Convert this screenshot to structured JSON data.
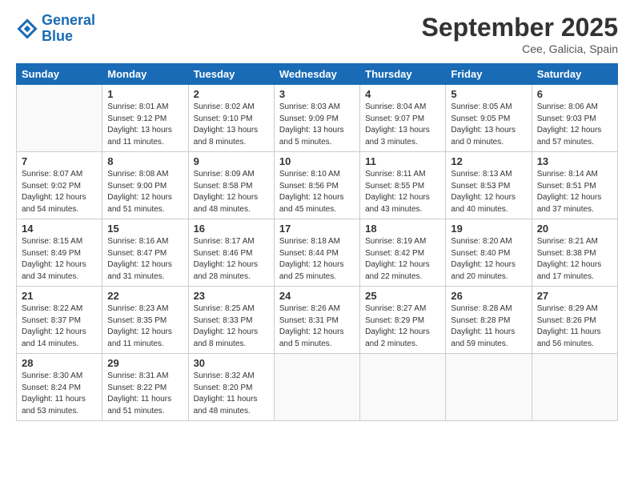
{
  "header": {
    "logo_line1": "General",
    "logo_line2": "Blue",
    "month_title": "September 2025",
    "subtitle": "Cee, Galicia, Spain"
  },
  "days_of_week": [
    "Sunday",
    "Monday",
    "Tuesday",
    "Wednesday",
    "Thursday",
    "Friday",
    "Saturday"
  ],
  "weeks": [
    [
      {
        "day": "",
        "info": ""
      },
      {
        "day": "1",
        "info": "Sunrise: 8:01 AM\nSunset: 9:12 PM\nDaylight: 13 hours\nand 11 minutes."
      },
      {
        "day": "2",
        "info": "Sunrise: 8:02 AM\nSunset: 9:10 PM\nDaylight: 13 hours\nand 8 minutes."
      },
      {
        "day": "3",
        "info": "Sunrise: 8:03 AM\nSunset: 9:09 PM\nDaylight: 13 hours\nand 5 minutes."
      },
      {
        "day": "4",
        "info": "Sunrise: 8:04 AM\nSunset: 9:07 PM\nDaylight: 13 hours\nand 3 minutes."
      },
      {
        "day": "5",
        "info": "Sunrise: 8:05 AM\nSunset: 9:05 PM\nDaylight: 13 hours\nand 0 minutes."
      },
      {
        "day": "6",
        "info": "Sunrise: 8:06 AM\nSunset: 9:03 PM\nDaylight: 12 hours\nand 57 minutes."
      }
    ],
    [
      {
        "day": "7",
        "info": "Sunrise: 8:07 AM\nSunset: 9:02 PM\nDaylight: 12 hours\nand 54 minutes."
      },
      {
        "day": "8",
        "info": "Sunrise: 8:08 AM\nSunset: 9:00 PM\nDaylight: 12 hours\nand 51 minutes."
      },
      {
        "day": "9",
        "info": "Sunrise: 8:09 AM\nSunset: 8:58 PM\nDaylight: 12 hours\nand 48 minutes."
      },
      {
        "day": "10",
        "info": "Sunrise: 8:10 AM\nSunset: 8:56 PM\nDaylight: 12 hours\nand 45 minutes."
      },
      {
        "day": "11",
        "info": "Sunrise: 8:11 AM\nSunset: 8:55 PM\nDaylight: 12 hours\nand 43 minutes."
      },
      {
        "day": "12",
        "info": "Sunrise: 8:13 AM\nSunset: 8:53 PM\nDaylight: 12 hours\nand 40 minutes."
      },
      {
        "day": "13",
        "info": "Sunrise: 8:14 AM\nSunset: 8:51 PM\nDaylight: 12 hours\nand 37 minutes."
      }
    ],
    [
      {
        "day": "14",
        "info": "Sunrise: 8:15 AM\nSunset: 8:49 PM\nDaylight: 12 hours\nand 34 minutes."
      },
      {
        "day": "15",
        "info": "Sunrise: 8:16 AM\nSunset: 8:47 PM\nDaylight: 12 hours\nand 31 minutes."
      },
      {
        "day": "16",
        "info": "Sunrise: 8:17 AM\nSunset: 8:46 PM\nDaylight: 12 hours\nand 28 minutes."
      },
      {
        "day": "17",
        "info": "Sunrise: 8:18 AM\nSunset: 8:44 PM\nDaylight: 12 hours\nand 25 minutes."
      },
      {
        "day": "18",
        "info": "Sunrise: 8:19 AM\nSunset: 8:42 PM\nDaylight: 12 hours\nand 22 minutes."
      },
      {
        "day": "19",
        "info": "Sunrise: 8:20 AM\nSunset: 8:40 PM\nDaylight: 12 hours\nand 20 minutes."
      },
      {
        "day": "20",
        "info": "Sunrise: 8:21 AM\nSunset: 8:38 PM\nDaylight: 12 hours\nand 17 minutes."
      }
    ],
    [
      {
        "day": "21",
        "info": "Sunrise: 8:22 AM\nSunset: 8:37 PM\nDaylight: 12 hours\nand 14 minutes."
      },
      {
        "day": "22",
        "info": "Sunrise: 8:23 AM\nSunset: 8:35 PM\nDaylight: 12 hours\nand 11 minutes."
      },
      {
        "day": "23",
        "info": "Sunrise: 8:25 AM\nSunset: 8:33 PM\nDaylight: 12 hours\nand 8 minutes."
      },
      {
        "day": "24",
        "info": "Sunrise: 8:26 AM\nSunset: 8:31 PM\nDaylight: 12 hours\nand 5 minutes."
      },
      {
        "day": "25",
        "info": "Sunrise: 8:27 AM\nSunset: 8:29 PM\nDaylight: 12 hours\nand 2 minutes."
      },
      {
        "day": "26",
        "info": "Sunrise: 8:28 AM\nSunset: 8:28 PM\nDaylight: 11 hours\nand 59 minutes."
      },
      {
        "day": "27",
        "info": "Sunrise: 8:29 AM\nSunset: 8:26 PM\nDaylight: 11 hours\nand 56 minutes."
      }
    ],
    [
      {
        "day": "28",
        "info": "Sunrise: 8:30 AM\nSunset: 8:24 PM\nDaylight: 11 hours\nand 53 minutes."
      },
      {
        "day": "29",
        "info": "Sunrise: 8:31 AM\nSunset: 8:22 PM\nDaylight: 11 hours\nand 51 minutes."
      },
      {
        "day": "30",
        "info": "Sunrise: 8:32 AM\nSunset: 8:20 PM\nDaylight: 11 hours\nand 48 minutes."
      },
      {
        "day": "",
        "info": ""
      },
      {
        "day": "",
        "info": ""
      },
      {
        "day": "",
        "info": ""
      },
      {
        "day": "",
        "info": ""
      }
    ]
  ]
}
